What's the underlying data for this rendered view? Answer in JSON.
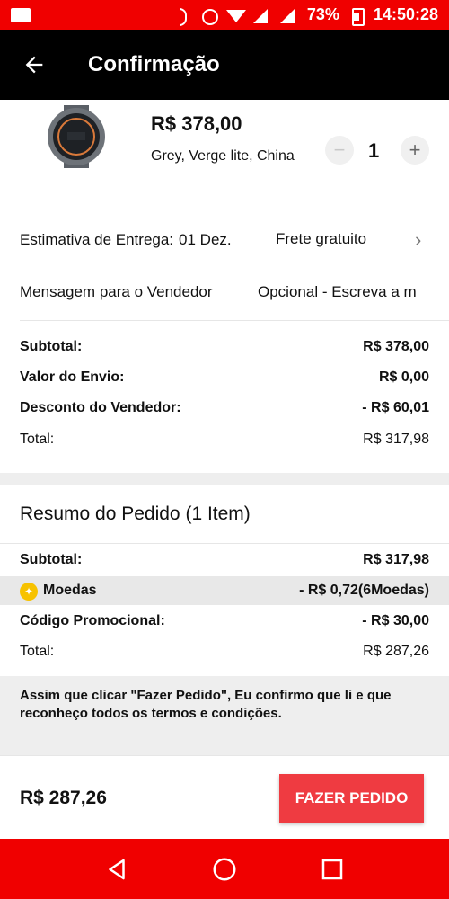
{
  "status_bar": {
    "battery": "73%",
    "time": "14:50:28"
  },
  "header": {
    "title": "Confirmação"
  },
  "product": {
    "price": "R$ 378,00",
    "variant": "Grey, Verge lite, China",
    "quantity": "1",
    "minus": "−",
    "plus": "+"
  },
  "delivery": {
    "label": "Estimativa de Entrega:",
    "date": "01 Dez.",
    "shipping": "Frete gratuito",
    "chevron": "›"
  },
  "message": {
    "label": "Mensagem para o Vendedor",
    "placeholder": "Opcional - Escreva a m"
  },
  "seller_summary": {
    "subtotal_label": "Subtotal:",
    "subtotal_value": "R$ 378,00",
    "shipping_label": "Valor do Envio:",
    "shipping_value": "R$ 0,00",
    "discount_label": "Desconto do Vendedor:",
    "discount_value": "- R$ 60,01",
    "total_label": "Total:",
    "total_value": "R$ 317,98"
  },
  "order_summary": {
    "title": "Resumo do Pedido (1 Item)",
    "subtotal_label": "Subtotal:",
    "subtotal_value": "R$ 317,98",
    "coins_label": "Moedas",
    "coins_value": "- R$ 0,72(6Moedas)",
    "promo_label": "Código Promocional:",
    "promo_value": "- R$ 30,00",
    "total_label": "Total:",
    "total_value": "R$ 287,26"
  },
  "terms": {
    "text": "Assim que clicar \"Fazer Pedido\", Eu confirmo que li e que reconheço todos os termos e condições."
  },
  "footer": {
    "total": "R$ 287,26",
    "order_button": "FAZER PEDIDO"
  },
  "colors": {
    "brand_red": "#f00000",
    "button_red": "#ef3b41",
    "coin_yellow": "#f7c200"
  },
  "icons": [
    "back-arrow-icon",
    "coin-icon",
    "chevron-right-icon",
    "nav-back-icon",
    "nav-home-icon",
    "nav-recents-icon"
  ]
}
